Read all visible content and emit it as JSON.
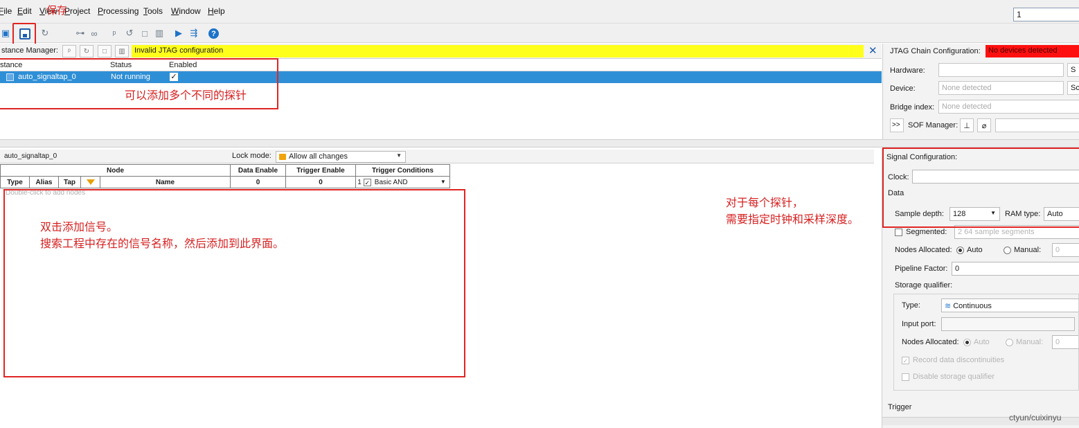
{
  "menubar": {
    "items": [
      {
        "pre": "",
        "u": "F",
        "rest": "ile"
      },
      {
        "pre": "",
        "u": "E",
        "rest": "dit"
      },
      {
        "pre": "",
        "u": "V",
        "rest": "iew"
      },
      {
        "pre": "",
        "u": "P",
        "rest": "roject"
      },
      {
        "pre": "",
        "u": "P",
        "rest": "rocessing"
      },
      {
        "pre": "",
        "u": "T",
        "rest": "ools"
      },
      {
        "pre": "",
        "u": "W",
        "rest": "indow"
      },
      {
        "pre": "",
        "u": "H",
        "rest": "elp"
      }
    ],
    "search_value": "1"
  },
  "toolbar": {
    "save_annotation": "保存",
    "icons": [
      "new-icon",
      "save-icon",
      "refresh-icon",
      "hierarchy-icon",
      "binoculars-icon",
      "trigger-icon",
      "undo-icon",
      "stop-icon",
      "book-icon",
      "run-icon",
      "autorun-icon",
      "help-icon"
    ]
  },
  "instance_manager": {
    "label": "stance Manager:",
    "warning": "Invalid JTAG configuration",
    "columns": [
      "stance",
      "Status",
      "Enabled"
    ],
    "rows": [
      {
        "name": "auto_signaltap_0",
        "status": "Not running",
        "enabled": "✓"
      }
    ],
    "annotation": "可以添加多个不同的探针"
  },
  "jtag": {
    "title": "JTAG Chain Configuration:",
    "status": "No devices detected",
    "hardware_label": "Hardware:",
    "device_label": "Device:",
    "device_value": "None detected",
    "bridge_label": "Bridge index:",
    "bridge_value": "None detected",
    "expand_label": ">>",
    "sof_label": "SOF Manager:",
    "setup_btn": "S",
    "scan_btn": "Sc"
  },
  "node_panel": {
    "instance_name": "auto_signaltap_0",
    "lock_label": "Lock mode:",
    "lock_value": "Allow all changes",
    "node_header": "Node",
    "data_enable_header": "Data Enable",
    "trigger_enable_header": "Trigger Enable",
    "trigger_conditions_header": "Trigger Conditions",
    "col_type": "Type",
    "col_alias": "Alias",
    "col_tap": "Tap",
    "col_name": "Name",
    "data_enable_value": "0",
    "trigger_enable_value": "0",
    "trigger_index": "1",
    "trigger_check": "✓",
    "trigger_condition": "Basic AND",
    "hint": "Double-click to add nodes",
    "annotation_line1": "双击添加信号。",
    "annotation_line2": "搜索工程中存在的信号名称，然后添加到此界面。"
  },
  "clock_annotation": {
    "line1": "对于每个探针，",
    "line2": "需要指定时钟和采样深度。"
  },
  "signal_config": {
    "title": "Signal Configuration:",
    "clock_label": "Clock:",
    "clock_value": "",
    "data_label": "Data",
    "sample_depth_label": "Sample depth:",
    "sample_depth_value": "128",
    "ram_type_label": "RAM type:",
    "ram_type_value": "Auto",
    "segmented_label": "Segmented:",
    "segmented_value": "2 64 sample segments",
    "nodes_allocated_label": "Nodes Allocated:",
    "auto_label": "Auto",
    "manual_label": "Manual:",
    "manual_value": "0",
    "pipeline_label": "Pipeline Factor:",
    "pipeline_value": "0",
    "storage_label": "Storage qualifier:",
    "type_label": "Type:",
    "type_value": "Continuous",
    "input_port_label": "Input port:",
    "sq_nodes_label": "Nodes Allocated:",
    "sq_auto_label": "Auto",
    "sq_manual_label": "Manual:",
    "sq_manual_value": "0",
    "record_label": "Record data discontinuities",
    "disable_label": "Disable storage qualifier",
    "trigger_label": "Trigger"
  },
  "credit": "ctyun/cuixinyu",
  "colors": {
    "annotation_red": "#e02424",
    "warning_yellow": "#ffff1c",
    "error_red": "#ff1010",
    "selection_blue": "#2f8fd6"
  }
}
